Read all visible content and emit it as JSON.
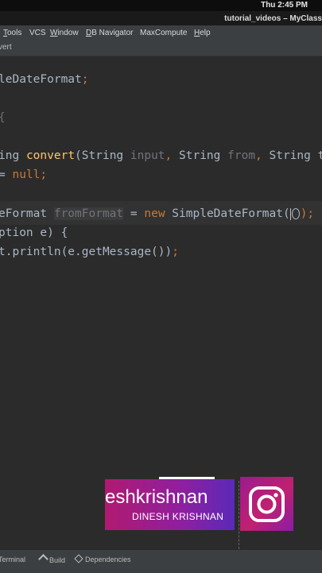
{
  "system": {
    "clock": "Thu  2:45 PM"
  },
  "window": {
    "title": "tutorial_videos – MyClass"
  },
  "menu": [
    {
      "label": "Tools",
      "u": "T",
      "rest": "ools"
    },
    {
      "label": "VCS",
      "u": "",
      "rest": "VCS"
    },
    {
      "label": "Window",
      "u": "W",
      "rest": "indow"
    },
    {
      "label": "DB Navigator",
      "u": "D",
      "rest": "B Navigator"
    },
    {
      "label": "MaxCompute",
      "u": "",
      "rest": "MaxCompute"
    },
    {
      "label": "Help",
      "u": "H",
      "rest": "elp"
    }
  ],
  "breadcrumb": {
    "item": "vert"
  },
  "code": {
    "line1": "leDateFormat",
    "line1_end": ";",
    "line2": "{",
    "line3_type": "ing",
    "line3_fn": "convert",
    "line3_open": "(String ",
    "line3_p1": "input",
    "line3_c1": ", ",
    "line3_t2": "String ",
    "line3_p2": "from",
    "line3_c2": ", ",
    "line3_t3": "String t",
    "line4_eq": "= ",
    "line4_null": "null",
    "line4_semi": ";",
    "line5_type": "eFormat ",
    "line5_var": "fromFormat",
    "line5_eq": " = ",
    "line5_new": "new",
    "line5_ctor": " SimpleDateFormat(",
    "line5_end": ");",
    "line6": "ption e) {",
    "line7_a": "t.println(e.getMessage())",
    "line7_semi": ";"
  },
  "overlay": {
    "handle": "eshkrishnan",
    "fullname": "DINESH  KRISHNAN",
    "icon": "instagram-icon"
  },
  "bottom_tabs": [
    {
      "label": "Terminal",
      "icon": "terminal-icon"
    },
    {
      "label": "Build",
      "icon": "hammer-icon"
    },
    {
      "label": "Dependencies",
      "icon": "dependencies-icon"
    }
  ]
}
